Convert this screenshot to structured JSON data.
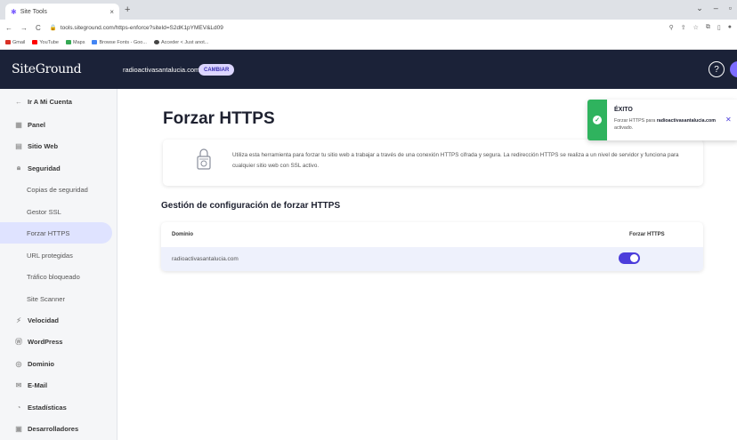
{
  "browser": {
    "tab_title": "Site Tools",
    "url": "tools.siteground.com/https-enforce?siteId=S2dK1pYMEV&Ld09",
    "bookmarks": [
      "Gmail",
      "YouTube",
      "Maps",
      "Browse Fonts - Goo...",
      "Acceder < Just anot..."
    ]
  },
  "header": {
    "logo": "SiteGround",
    "site": "radioactivasantalucia.com",
    "cambiar": "CAMBIAR",
    "help": "?"
  },
  "sidebar": {
    "items": [
      {
        "label": "Ir A Mi Cuenta"
      },
      {
        "label": "Panel"
      },
      {
        "label": "Sitio Web"
      },
      {
        "label": "Seguridad"
      },
      {
        "label": "Copias de seguridad"
      },
      {
        "label": "Gestor SSL"
      },
      {
        "label": "Forzar HTTPS"
      },
      {
        "label": "URL protegidas"
      },
      {
        "label": "Tráfico bloqueado"
      },
      {
        "label": "Site Scanner"
      },
      {
        "label": "Velocidad"
      },
      {
        "label": "WordPress"
      },
      {
        "label": "Dominio"
      },
      {
        "label": "E-Mail"
      },
      {
        "label": "Estadísticas"
      },
      {
        "label": "Desarrolladores"
      }
    ]
  },
  "main": {
    "title": "Forzar HTTPS",
    "info": "Utiliza esta herramienta para forzar tu sitio web a trabajar a través de una conexión HTTPS cifrada y segura. La redirección HTTPS se realiza a un nivel de servidor y funciona para cualquier sitio web con SSL activo.",
    "section_title": "Gestión de configuración de forzar HTTPS",
    "table": {
      "col_domain": "Dominio",
      "col_force": "Forzar HTTPS",
      "row_domain": "radioactivasantalucia.com",
      "force_enabled": true
    }
  },
  "toast": {
    "title": "ÉXITO",
    "msg_prefix": "Forzar HTTPS para",
    "msg_domain": "radioactivasantalucia.com",
    "msg_suffix": "activado."
  },
  "colors": {
    "header_bg": "#1b2238",
    "accent": "#4c3ddb",
    "success": "#2fb35e"
  }
}
